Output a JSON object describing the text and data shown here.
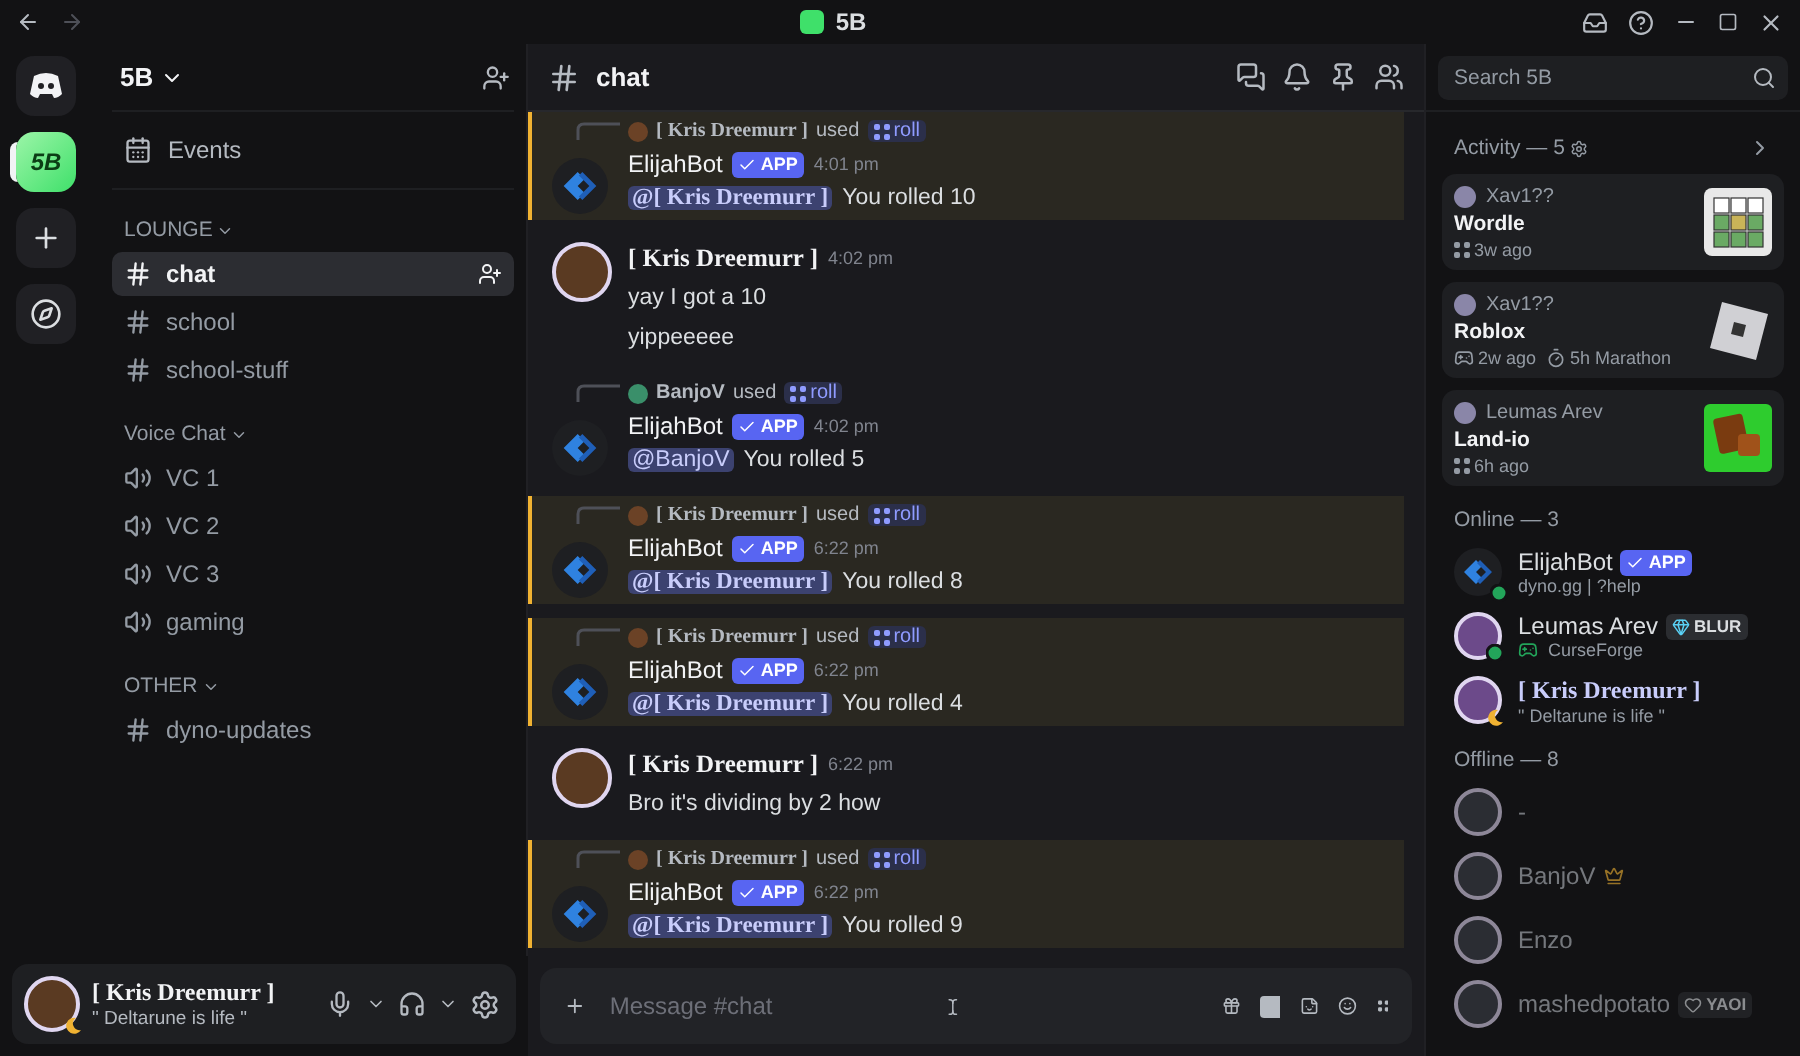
{
  "titlebar": {
    "title": "5B"
  },
  "servers": [
    {
      "kind": "home",
      "selected": false
    },
    {
      "kind": "server",
      "label": "5B",
      "selected": true
    },
    {
      "kind": "add",
      "selected": false
    },
    {
      "kind": "discover",
      "selected": false
    }
  ],
  "sidebar": {
    "server_name": "5B",
    "events": "Events",
    "categories": [
      {
        "name": "LOUNGE",
        "channels": [
          {
            "name": "chat",
            "kind": "text",
            "selected": true
          },
          {
            "name": "school",
            "kind": "text",
            "selected": false
          },
          {
            "name": "school-stuff",
            "kind": "text",
            "selected": false
          }
        ]
      },
      {
        "name": "Voice Chat",
        "channels": [
          {
            "name": "VC 1",
            "kind": "voice",
            "selected": false
          },
          {
            "name": "VC 2",
            "kind": "voice",
            "selected": false
          },
          {
            "name": "VC 3",
            "kind": "voice",
            "selected": false
          },
          {
            "name": "gaming",
            "kind": "voice",
            "selected": false
          }
        ]
      },
      {
        "name": "OTHER",
        "channels": [
          {
            "name": "dyno-updates",
            "kind": "text",
            "selected": false
          }
        ]
      }
    ]
  },
  "user_panel": {
    "name": "[ Kris Dreemurr ]",
    "status_text": "\" Deltarune is life \"",
    "idle": true
  },
  "header": {
    "channel": "chat"
  },
  "search": {
    "placeholder": "Search 5B"
  },
  "messages": [
    {
      "kind": "bot",
      "highlighted": true,
      "invoker": "[ Kris Dreemurr ]",
      "serif": true,
      "used": "used",
      "command": "roll",
      "author": "ElijahBot",
      "badge": "APP",
      "time": "4:01 pm",
      "mention": "@[ Kris Dreemurr ]",
      "text": "You rolled 10"
    },
    {
      "kind": "user",
      "author": "[ Kris Dreemurr ]",
      "serif": true,
      "time": "4:02 pm",
      "lines": [
        "yay I got a 10",
        "yippeeeee"
      ]
    },
    {
      "kind": "bot",
      "highlighted": false,
      "invoker": "BanjoV",
      "serif": false,
      "used": "used",
      "command": "roll",
      "author": "ElijahBot",
      "badge": "APP",
      "time": "4:02 pm",
      "mention": "@BanjoV",
      "text": "You rolled 5"
    },
    {
      "kind": "bot",
      "highlighted": true,
      "invoker": "[ Kris Dreemurr ]",
      "serif": true,
      "used": "used",
      "command": "roll",
      "author": "ElijahBot",
      "badge": "APP",
      "time": "6:22 pm",
      "mention": "@[ Kris Dreemurr ]",
      "text": "You rolled 8"
    },
    {
      "kind": "bot",
      "highlighted": true,
      "invoker": "[ Kris Dreemurr ]",
      "serif": true,
      "used": "used",
      "command": "roll",
      "author": "ElijahBot",
      "badge": "APP",
      "time": "6:22 pm",
      "mention": "@[ Kris Dreemurr ]",
      "text": "You rolled 4"
    },
    {
      "kind": "user",
      "author": "[ Kris Dreemurr ]",
      "serif": true,
      "time": "6:22 pm",
      "lines": [
        "Bro it's dividing by 2 how"
      ]
    },
    {
      "kind": "bot",
      "highlighted": true,
      "invoker": "[ Kris Dreemurr ]",
      "serif": true,
      "used": "used",
      "command": "roll",
      "author": "ElijahBot",
      "badge": "APP",
      "time": "6:22 pm",
      "mention": "@[ Kris Dreemurr ]",
      "text": "You rolled 9"
    }
  ],
  "composer": {
    "placeholder": "Message #chat"
  },
  "members": {
    "activity": {
      "heading": "Activity — 5",
      "items": [
        {
          "user": "Xav1??",
          "title": "Wordle",
          "kind": "grid",
          "meta": [
            {
              "kind": "app",
              "text": "3w ago"
            }
          ]
        },
        {
          "user": "Xav1??",
          "title": "Roblox",
          "kind": "tile",
          "meta": [
            {
              "kind": "game",
              "text": "2w ago"
            },
            {
              "kind": "timer",
              "text": "5h Marathon"
            }
          ]
        },
        {
          "user": "Leumas Arev",
          "title": "Land-io",
          "kind": "blocks",
          "meta": [
            {
              "kind": "app",
              "text": "6h ago"
            }
          ]
        }
      ]
    },
    "online": {
      "heading": "Online — 3",
      "items": [
        {
          "name": "ElijahBot",
          "serif": false,
          "kind": "bot",
          "idle": false,
          "badge": {
            "kind": "app",
            "text": "APP"
          },
          "activity": {
            "kind": "plain",
            "text": "dyno.gg | ?help"
          }
        },
        {
          "name": "Leumas Arev",
          "serif": false,
          "kind": "user",
          "idle": false,
          "badge": {
            "kind": "gem",
            "text": "BLUR"
          },
          "activity": {
            "kind": "game",
            "text": "CurseForge"
          }
        },
        {
          "name": "[ Kris Dreemurr ]",
          "serif": true,
          "kind": "user",
          "idle": true,
          "activity": {
            "kind": "plain",
            "text": "\" Deltarune is life \""
          }
        }
      ]
    },
    "offline": {
      "heading": "Offline — 8",
      "items": [
        {
          "name": "-",
          "kind": "user"
        },
        {
          "name": "BanjoV",
          "kind": "user",
          "badge": {
            "kind": "crown"
          }
        },
        {
          "name": "Enzo",
          "kind": "user"
        },
        {
          "name": "mashedpotato",
          "kind": "user",
          "badge": {
            "kind": "heart",
            "text": "YAOI"
          }
        }
      ]
    }
  }
}
